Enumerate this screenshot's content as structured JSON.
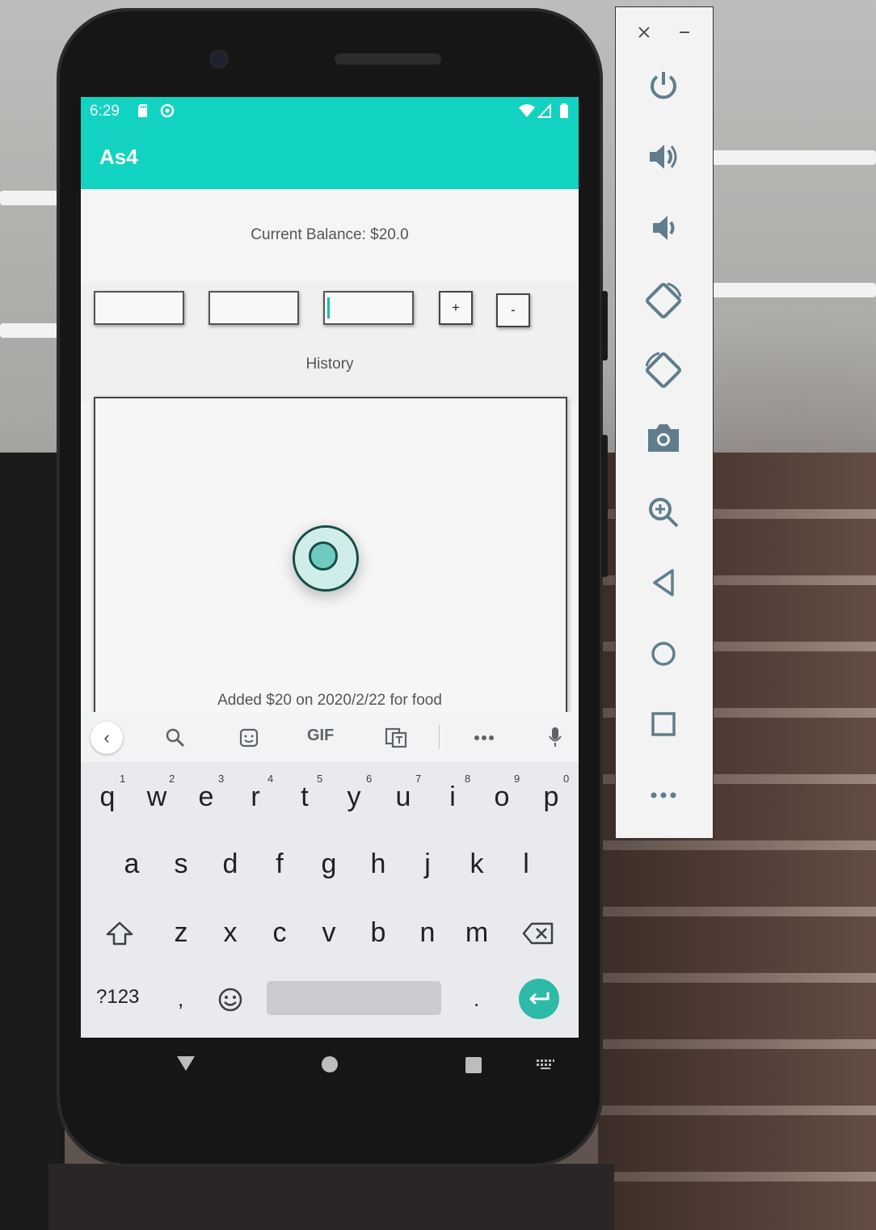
{
  "status_bar": {
    "time": "6:29"
  },
  "app": {
    "title": "As4"
  },
  "balance": {
    "text": "Current Balance: $20.0"
  },
  "inputs": [
    {
      "value": ""
    },
    {
      "value": ""
    },
    {
      "value": ""
    }
  ],
  "buttons": {
    "add_label": "+",
    "subtract_label": "-"
  },
  "history": {
    "label": "History",
    "entries": [
      "Added $20 on 2020/2/22 for food"
    ]
  },
  "keyboard": {
    "toolbar": {
      "gif_label": "GIF"
    },
    "row1": [
      "q",
      "w",
      "e",
      "r",
      "t",
      "y",
      "u",
      "i",
      "o",
      "p"
    ],
    "row1_hints": [
      "1",
      "2",
      "3",
      "4",
      "5",
      "6",
      "7",
      "8",
      "9",
      "0"
    ],
    "row2": [
      "a",
      "s",
      "d",
      "f",
      "g",
      "h",
      "j",
      "k",
      "l"
    ],
    "row3": [
      "z",
      "x",
      "c",
      "v",
      "b",
      "n",
      "m"
    ],
    "bottom": {
      "symbols_label": "?123",
      "comma": ",",
      "period": "."
    }
  },
  "colors": {
    "accent": "#12d3c1",
    "enter": "#2dbaa9",
    "panel_icon": "#607d8b"
  },
  "panel_icons": [
    "close-icon",
    "minimize-icon",
    "power-icon",
    "volume-up-icon",
    "volume-down-icon",
    "rotate-left-icon",
    "rotate-right-icon",
    "camera-icon",
    "zoom-icon",
    "back-icon",
    "home-icon",
    "overview-icon",
    "more-icon"
  ]
}
